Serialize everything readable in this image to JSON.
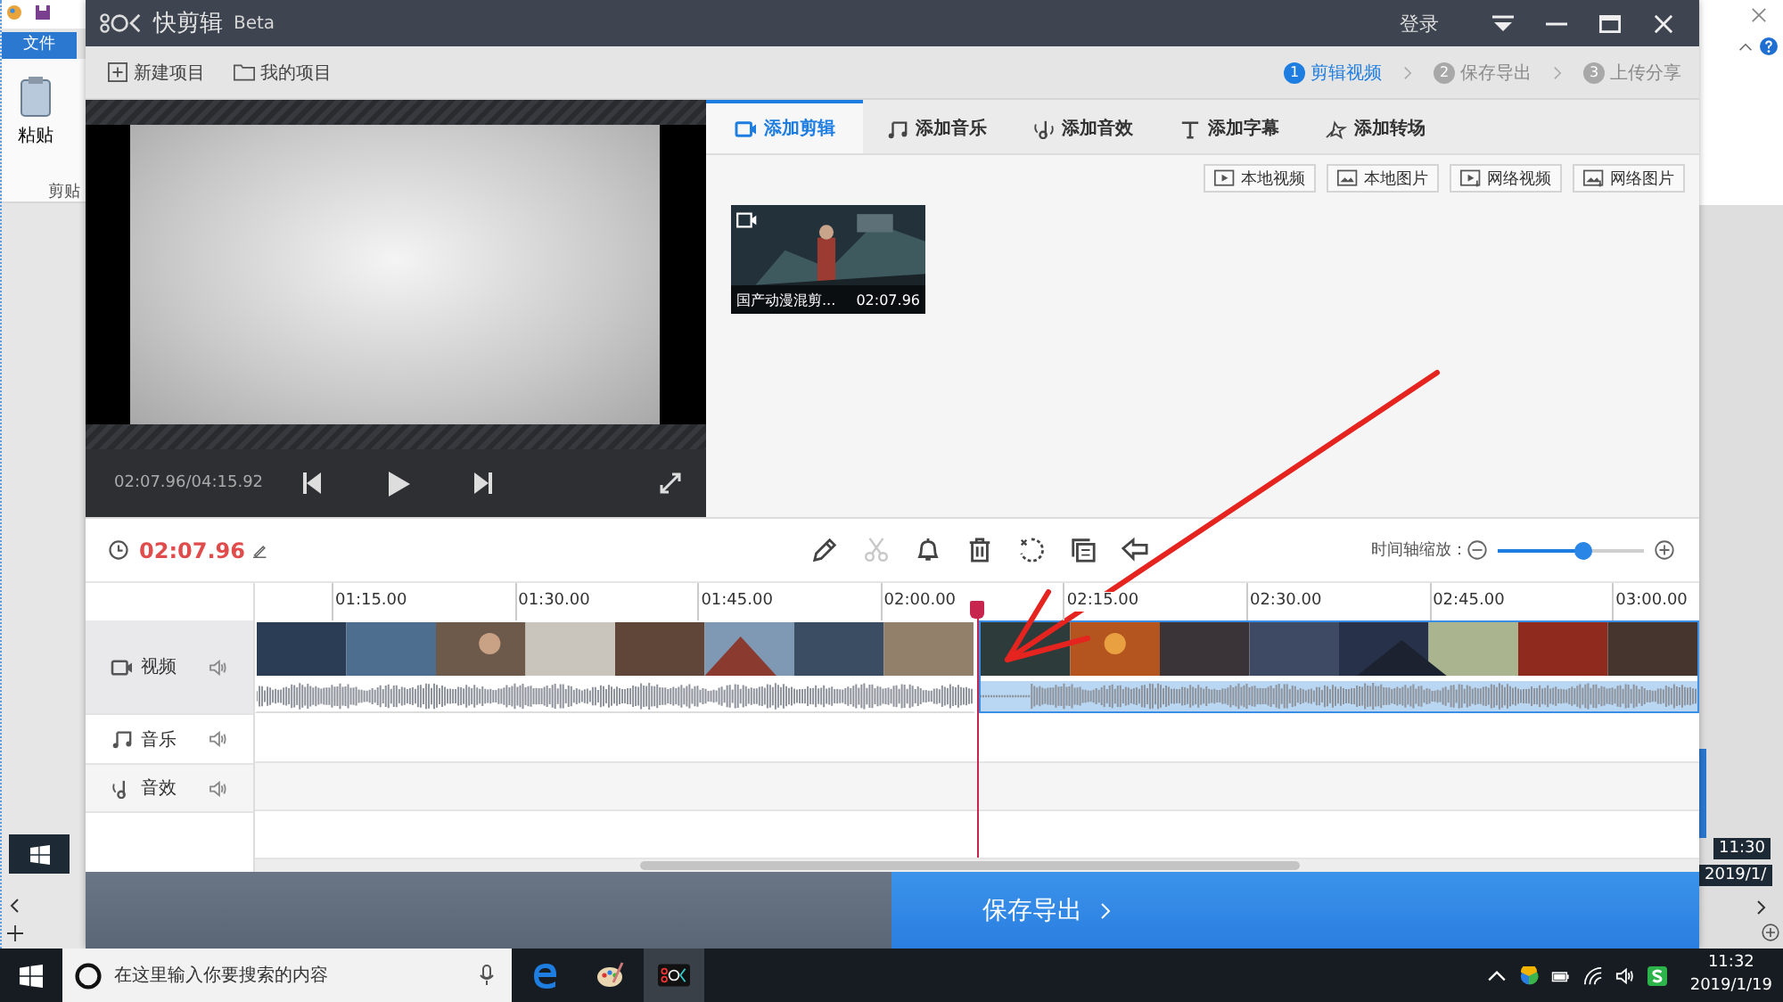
{
  "background_app": {
    "ribbon_tab": "文件",
    "paste_label": "粘贴",
    "group_label": "剪贴",
    "inner_time": "11:30",
    "inner_date": "2019/1/"
  },
  "window": {
    "title": "快剪辑",
    "badge": "Beta",
    "login": "登录"
  },
  "toolbar": {
    "actions": [
      "新建项目",
      "我的项目"
    ],
    "steps": [
      {
        "number": "1",
        "label": "剪辑视频",
        "selected": true
      },
      {
        "number": "2",
        "label": "保存导出",
        "selected": false
      },
      {
        "number": "3",
        "label": "上传分享",
        "selected": false
      }
    ]
  },
  "preview": {
    "time": "02:07.96/04:15.92"
  },
  "tabs": [
    {
      "kind": "clip",
      "label": "添加剪辑",
      "selected": true
    },
    {
      "kind": "music",
      "label": "添加音乐",
      "selected": false
    },
    {
      "kind": "effect",
      "label": "添加音效",
      "selected": false
    },
    {
      "kind": "text",
      "label": "添加字幕",
      "selected": false
    },
    {
      "kind": "transition",
      "label": "添加转场",
      "selected": false
    }
  ],
  "source_buttons": [
    "本地视频",
    "本地图片",
    "网络视频",
    "网络图片"
  ],
  "media": [
    {
      "title": "国产动漫混剪...",
      "duration": "02:07.96"
    }
  ],
  "timeline": {
    "current_time": "02:07.96",
    "zoom_label": "时间轴缩放：",
    "zoom": {
      "level": 0.58
    },
    "tools": [
      {
        "kind": "pencil",
        "disabled": false
      },
      {
        "kind": "scissors",
        "disabled": true
      },
      {
        "kind": "bell",
        "disabled": false
      },
      {
        "kind": "trash",
        "disabled": false
      },
      {
        "kind": "sparkle",
        "disabled": false
      },
      {
        "kind": "copy",
        "disabled": false
      },
      {
        "kind": "undo",
        "disabled": false
      }
    ],
    "ticks": [
      "01:15.00",
      "01:30.00",
      "01:45.00",
      "02:00.00",
      "02:15.00",
      "02:30.00",
      "02:45.00",
      "03:00.00"
    ],
    "tracks": [
      {
        "kind": "video",
        "label": "视频"
      },
      {
        "kind": "music",
        "label": "音乐"
      },
      {
        "kind": "effect",
        "label": "音效"
      }
    ],
    "clips": [
      {
        "selected": false
      },
      {
        "selected": true
      }
    ]
  },
  "footer": {
    "export": "保存导出"
  },
  "taskbar": {
    "search_placeholder": "在这里输入你要搜索的内容",
    "time": "11:32",
    "date": "2019/1/19"
  }
}
